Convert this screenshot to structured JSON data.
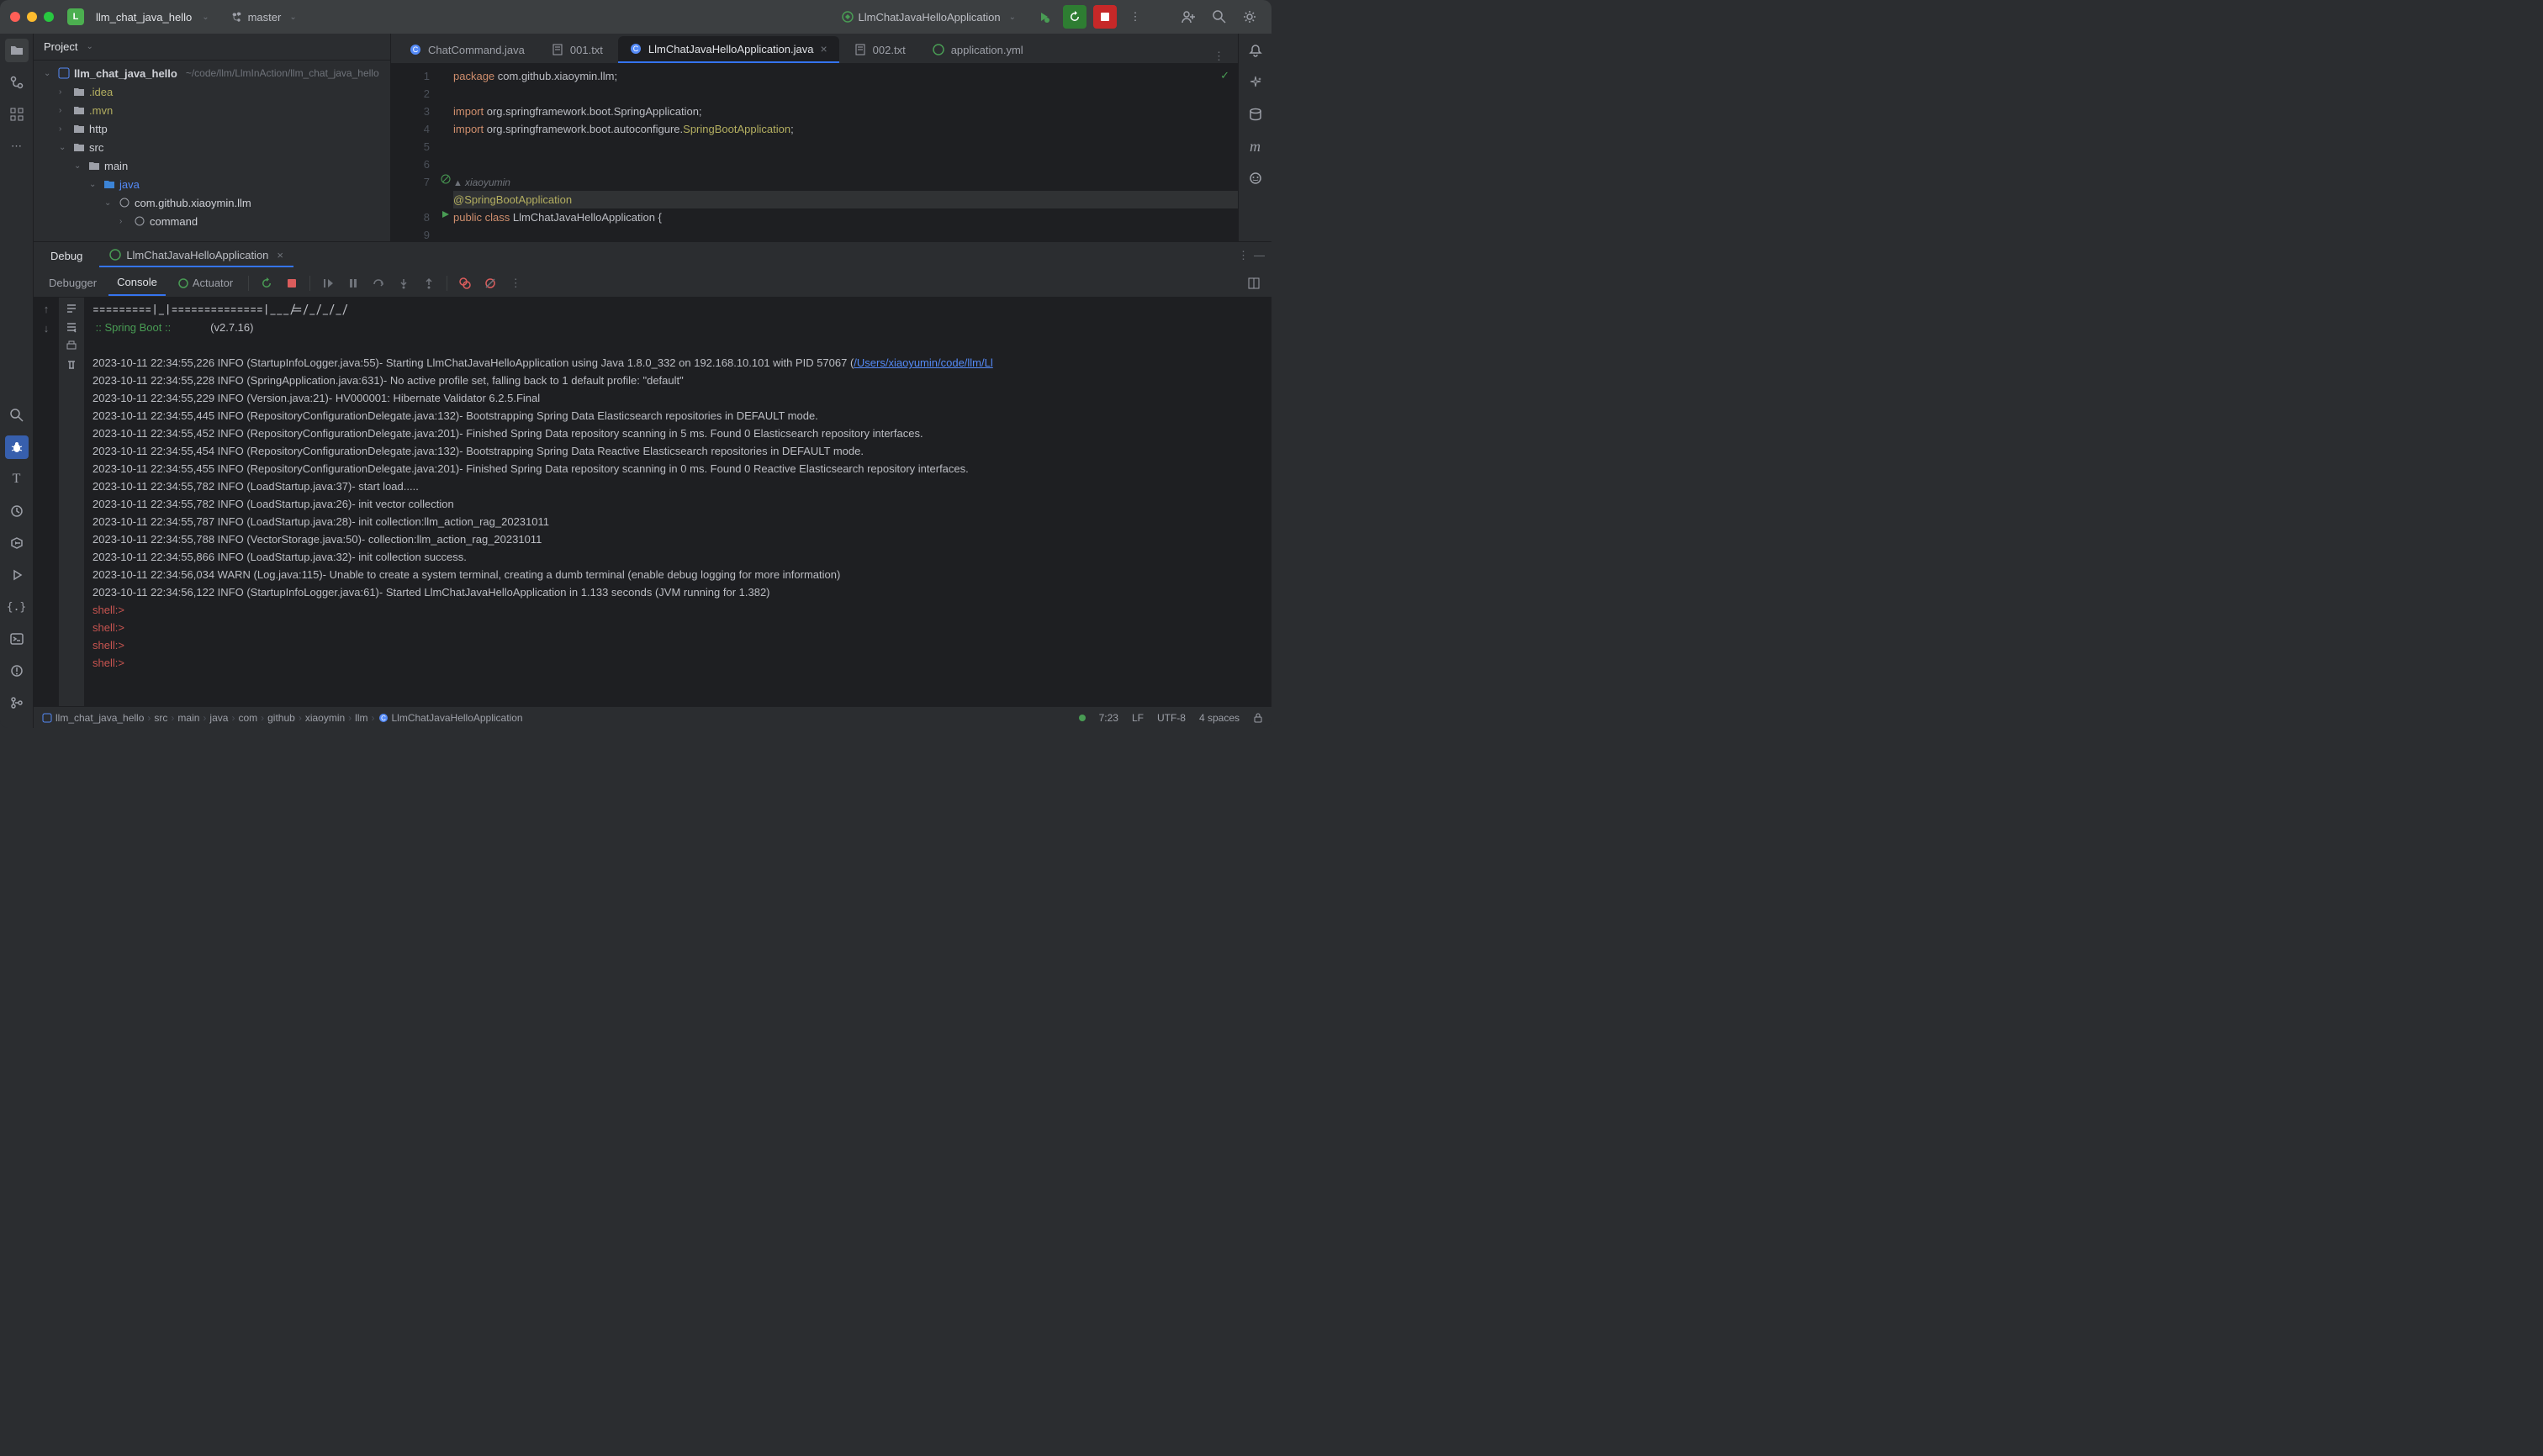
{
  "titlebar": {
    "project_letter": "L",
    "project_name": "llm_chat_java_hello",
    "branch": "master",
    "run_config": "LlmChatJavaHelloApplication"
  },
  "project_panel": {
    "title": "Project",
    "root": "llm_chat_java_hello",
    "root_path": "~/code/llm/LlmInAction/llm_chat_java_hello",
    "items": [
      {
        "name": ".idea",
        "indent": 1,
        "toggle": "›"
      },
      {
        "name": ".mvn",
        "indent": 1,
        "toggle": "›"
      },
      {
        "name": "http",
        "indent": 1,
        "toggle": "›"
      },
      {
        "name": "src",
        "indent": 1,
        "toggle": "⌄"
      },
      {
        "name": "main",
        "indent": 2,
        "toggle": "⌄"
      },
      {
        "name": "java",
        "indent": 3,
        "toggle": "⌄",
        "srcroot": true
      },
      {
        "name": "com.github.xiaoymin.llm",
        "indent": 4,
        "toggle": "⌄",
        "pkg": true
      },
      {
        "name": "command",
        "indent": 5,
        "toggle": "›",
        "pkg": true
      }
    ]
  },
  "tabs": [
    {
      "label": "ChatCommand.java",
      "icon": "class",
      "active": false
    },
    {
      "label": "001.txt",
      "icon": "txt",
      "active": false
    },
    {
      "label": "LlmChatJavaHelloApplication.java",
      "icon": "class",
      "active": true,
      "closable": true
    },
    {
      "label": "002.txt",
      "icon": "txt",
      "active": false
    },
    {
      "label": "application.yml",
      "icon": "yml",
      "active": false
    }
  ],
  "code_author": "xiaoyumin",
  "code_lines": [
    {
      "n": 1,
      "html": "<span class='kw'>package</span> <span class='pkg'>com.github.xiaoymin.llm;</span>"
    },
    {
      "n": 2,
      "html": ""
    },
    {
      "n": 3,
      "html": "<span class='kw'>import</span> <span class='pkg'>org.springframework.boot.SpringApplication;</span>"
    },
    {
      "n": 4,
      "html": "<span class='kw'>import</span> <span class='pkg'>org.springframework.boot.autoconfigure.</span><span class='ann'>SpringBootApplication</span><span class='pkg'>;</span>"
    },
    {
      "n": 5,
      "html": ""
    },
    {
      "n": 6,
      "html": ""
    },
    {
      "n": 7,
      "html": "<span class='ann'>@SpringBootApplication</span>",
      "run": "⊘"
    },
    {
      "n": 8,
      "html": "<span class='kw'>public</span> <span class='kw'>class</span> <span class='cls'>LlmChatJavaHelloApplication</span> {",
      "run": "▶"
    },
    {
      "n": 9,
      "html": ""
    }
  ],
  "debug": {
    "label": "Debug",
    "run_name": "LlmChatJavaHelloApplication",
    "tabs": {
      "debugger": "Debugger",
      "console": "Console",
      "actuator": "Actuator"
    }
  },
  "console_spring": {
    "line1": "=========|_|==============|___/=/_/_/_/",
    "line2": " :: Spring Boot ::             ",
    "version": "(v2.7.16)"
  },
  "console_lines": [
    "2023-10-11 22:34:55,226 INFO (StartupInfoLogger.java:55)- Starting LlmChatJavaHelloApplication using Java 1.8.0_332 on 192.168.10.101 with PID 57067 (",
    "2023-10-11 22:34:55,228 INFO (SpringApplication.java:631)- No active profile set, falling back to 1 default profile: \"default\"",
    "2023-10-11 22:34:55,229 INFO (Version.java:21)- HV000001: Hibernate Validator 6.2.5.Final",
    "2023-10-11 22:34:55,445 INFO (RepositoryConfigurationDelegate.java:132)- Bootstrapping Spring Data Elasticsearch repositories in DEFAULT mode.",
    "2023-10-11 22:34:55,452 INFO (RepositoryConfigurationDelegate.java:201)- Finished Spring Data repository scanning in 5 ms. Found 0 Elasticsearch repository interfaces.",
    "2023-10-11 22:34:55,454 INFO (RepositoryConfigurationDelegate.java:132)- Bootstrapping Spring Data Reactive Elasticsearch repositories in DEFAULT mode.",
    "2023-10-11 22:34:55,455 INFO (RepositoryConfigurationDelegate.java:201)- Finished Spring Data repository scanning in 0 ms. Found 0 Reactive Elasticsearch repository interfaces.",
    "2023-10-11 22:34:55,782 INFO (LoadStartup.java:37)- start load.....",
    "2023-10-11 22:34:55,782 INFO (LoadStartup.java:26)- init vector collection",
    "2023-10-11 22:34:55,787 INFO (LoadStartup.java:28)- init collection:llm_action_rag_20231011",
    "2023-10-11 22:34:55,788 INFO (VectorStorage.java:50)- collection:llm_action_rag_20231011",
    "2023-10-11 22:34:55,866 INFO (LoadStartup.java:32)- init collection success.",
    "2023-10-11 22:34:56,034 WARN (Log.java:115)- Unable to create a system terminal, creating a dumb terminal (enable debug logging for more information)",
    "2023-10-11 22:34:56,122 INFO (StartupInfoLogger.java:61)- Started LlmChatJavaHelloApplication in 1.133 seconds (JVM running for 1.382)"
  ],
  "console_link": "/Users/xiaoyumin/code/llm/Ll",
  "shell_prompt": "shell:>",
  "breadcrumbs": [
    "llm_chat_java_hello",
    "src",
    "main",
    "java",
    "com",
    "github",
    "xiaoymin",
    "llm",
    "LlmChatJavaHelloApplication"
  ],
  "statusbar": {
    "pos": "7:23",
    "eol": "LF",
    "enc": "UTF-8",
    "indent": "4 spaces"
  }
}
